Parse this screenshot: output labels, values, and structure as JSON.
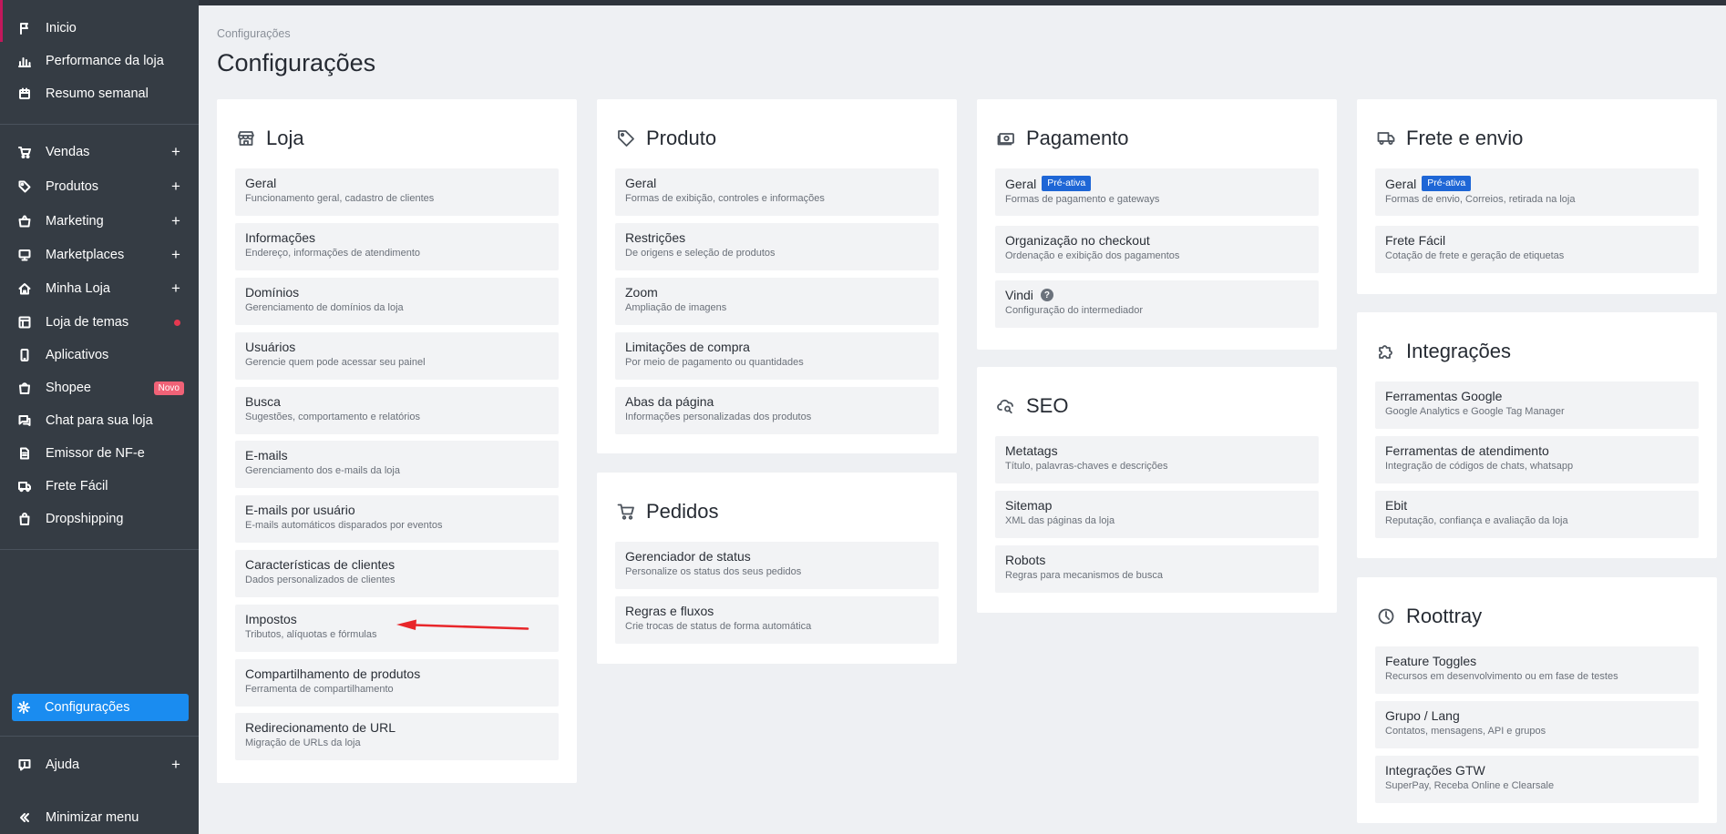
{
  "sidebar": {
    "items": [
      {
        "label": "Inicio",
        "icon": "flag-icon"
      },
      {
        "label": "Performance da loja",
        "icon": "bar-chart-icon"
      },
      {
        "label": "Resumo semanal",
        "icon": "calendar-icon"
      },
      {
        "label": "Vendas",
        "icon": "cart-icon"
      },
      {
        "label": "Produtos",
        "icon": "tag-icon"
      },
      {
        "label": "Marketing",
        "icon": "basket-icon"
      },
      {
        "label": "Marketplaces",
        "icon": "monitor-icon"
      },
      {
        "label": "Minha Loja",
        "icon": "home-icon"
      },
      {
        "label": "Loja de temas",
        "icon": "layout-icon"
      },
      {
        "label": "Aplicativos",
        "icon": "phone-icon"
      },
      {
        "label": "Shopee",
        "icon": "shopee-icon",
        "badge": "Novo"
      },
      {
        "label": "Chat para sua loja",
        "icon": "chat-icon"
      },
      {
        "label": "Emissor de NF-e",
        "icon": "document-icon"
      },
      {
        "label": "Frete Fácil",
        "icon": "truck-icon"
      },
      {
        "label": "Dropshipping",
        "icon": "bag-icon"
      }
    ],
    "settings_label": "Configurações",
    "help_label": "Ajuda",
    "minimize_label": "Minimizar menu",
    "accent_color": "#c2185b",
    "active_color": "#1a8cf0"
  },
  "breadcrumb": "Configurações",
  "page_title": "Configurações",
  "cards": {
    "loja": {
      "title": "Loja",
      "items": [
        {
          "title": "Geral",
          "sub": "Funcionamento geral, cadastro de clientes"
        },
        {
          "title": "Informações",
          "sub": "Endereço, informações de atendimento"
        },
        {
          "title": "Domínios",
          "sub": "Gerenciamento de domínios da loja"
        },
        {
          "title": "Usuários",
          "sub": "Gerencie quem pode acessar seu painel"
        },
        {
          "title": "Busca",
          "sub": "Sugestões, comportamento e relatórios"
        },
        {
          "title": "E-mails",
          "sub": "Gerenciamento dos e-mails da loja"
        },
        {
          "title": "E-mails por usuário",
          "sub": "E-mails automáticos disparados por eventos"
        },
        {
          "title": "Características de clientes",
          "sub": "Dados personalizados de clientes"
        },
        {
          "title": "Impostos",
          "sub": "Tributos, alíquotas e fórmulas"
        },
        {
          "title": "Compartilhamento de produtos",
          "sub": "Ferramenta de compartilhamento"
        },
        {
          "title": "Redirecionamento de URL",
          "sub": "Migração de URLs da loja"
        }
      ]
    },
    "produto": {
      "title": "Produto",
      "items": [
        {
          "title": "Geral",
          "sub": "Formas de exibição, controles e informações"
        },
        {
          "title": "Restrições",
          "sub": "De origens e seleção de produtos"
        },
        {
          "title": "Zoom",
          "sub": "Ampliação de imagens"
        },
        {
          "title": "Limitações de compra",
          "sub": "Por meio de pagamento ou quantidades"
        },
        {
          "title": "Abas da página",
          "sub": "Informações personalizadas dos produtos"
        }
      ]
    },
    "pedidos": {
      "title": "Pedidos",
      "items": [
        {
          "title": "Gerenciador de status",
          "sub": "Personalize os status dos seus pedidos"
        },
        {
          "title": "Regras e fluxos",
          "sub": "Crie trocas de status de forma automática"
        }
      ]
    },
    "pagamento": {
      "title": "Pagamento",
      "items": [
        {
          "title": "Geral",
          "sub": "Formas de pagamento e gateways",
          "badge": "Pré-ativa"
        },
        {
          "title": "Organização no checkout",
          "sub": "Ordenação e exibição dos pagamentos"
        },
        {
          "title": "Vindi",
          "sub": "Configuração do intermediador",
          "help": "?"
        }
      ]
    },
    "seo": {
      "title": "SEO",
      "items": [
        {
          "title": "Metatags",
          "sub": "Título, palavras-chaves e descrições"
        },
        {
          "title": "Sitemap",
          "sub": "XML das páginas da loja"
        },
        {
          "title": "Robots",
          "sub": "Regras para mecanismos de busca"
        }
      ]
    },
    "frete": {
      "title": "Frete e envio",
      "items": [
        {
          "title": "Geral",
          "sub": "Formas de envio, Correios, retirada na loja",
          "badge": "Pré-ativa"
        },
        {
          "title": "Frete Fácil",
          "sub": "Cotação de frete e geração de etiquetas"
        }
      ]
    },
    "integracoes": {
      "title": "Integrações",
      "items": [
        {
          "title": "Ferramentas Google",
          "sub": "Google Analytics e Google Tag Manager"
        },
        {
          "title": "Ferramentas de atendimento",
          "sub": "Integração de códigos de chats, whatsapp"
        },
        {
          "title": "Ebit",
          "sub": "Reputação, confiança e avaliação da loja"
        }
      ]
    },
    "roottray": {
      "title": "Roottray",
      "items": [
        {
          "title": "Feature Toggles",
          "sub": "Recursos em desenvolvimento ou em fase de testes"
        },
        {
          "title": "Grupo / Lang",
          "sub": "Contatos, mensagens, API e grupos"
        },
        {
          "title": "Integrações GTW",
          "sub": "SuperPay, Receba Online e Clearsale"
        }
      ]
    }
  },
  "colors": {
    "badge_blue": "#1e66d6",
    "annotation_arrow": "#e8262a",
    "new_badge": "#f06277"
  }
}
